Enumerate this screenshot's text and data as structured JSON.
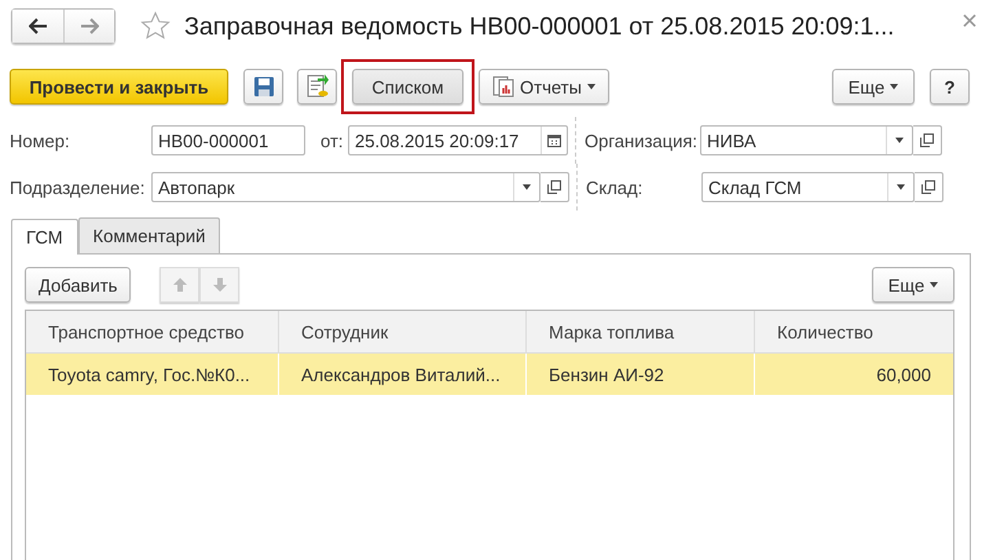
{
  "window": {
    "title": "Заправочная ведомость НВ00-000001 от 25.08.2015 20:09:1..."
  },
  "toolbar": {
    "primary": "Провести и закрыть",
    "list_button": {
      "label": "Списком",
      "highlighted": true
    },
    "reports": "Отчеты",
    "more": "Еще",
    "help": "?"
  },
  "fields": [
    {
      "label": "Номер:",
      "value": "НВ00-000001"
    },
    {
      "label": "от:",
      "value": "25.08.2015 20:09:17",
      "kind": "date"
    },
    {
      "label": "Организация:",
      "value": "НИВА",
      "kind": "select"
    },
    {
      "label": "Подразделение:",
      "value": "Автопарк",
      "kind": "select"
    },
    {
      "label": "Склад:",
      "value": "Склад ГСМ",
      "kind": "select"
    }
  ],
  "tabs": [
    {
      "label": "ГСМ",
      "selected": true
    },
    {
      "label": "Комментарий",
      "selected": false
    }
  ],
  "table_toolbar": {
    "add": "Добавить",
    "move_up_disabled": true,
    "move_down_disabled": true,
    "more": "Еще"
  },
  "table": {
    "columns": [
      "Транспортное средство",
      "Сотрудник",
      "Марка топлива",
      "Количество"
    ],
    "rows": [
      {
        "cells": [
          "Toyota camry, Гос.№К0...",
          "Александров Виталий...",
          "Бензин АИ-92",
          "60,000"
        ],
        "selected": true
      }
    ]
  }
}
